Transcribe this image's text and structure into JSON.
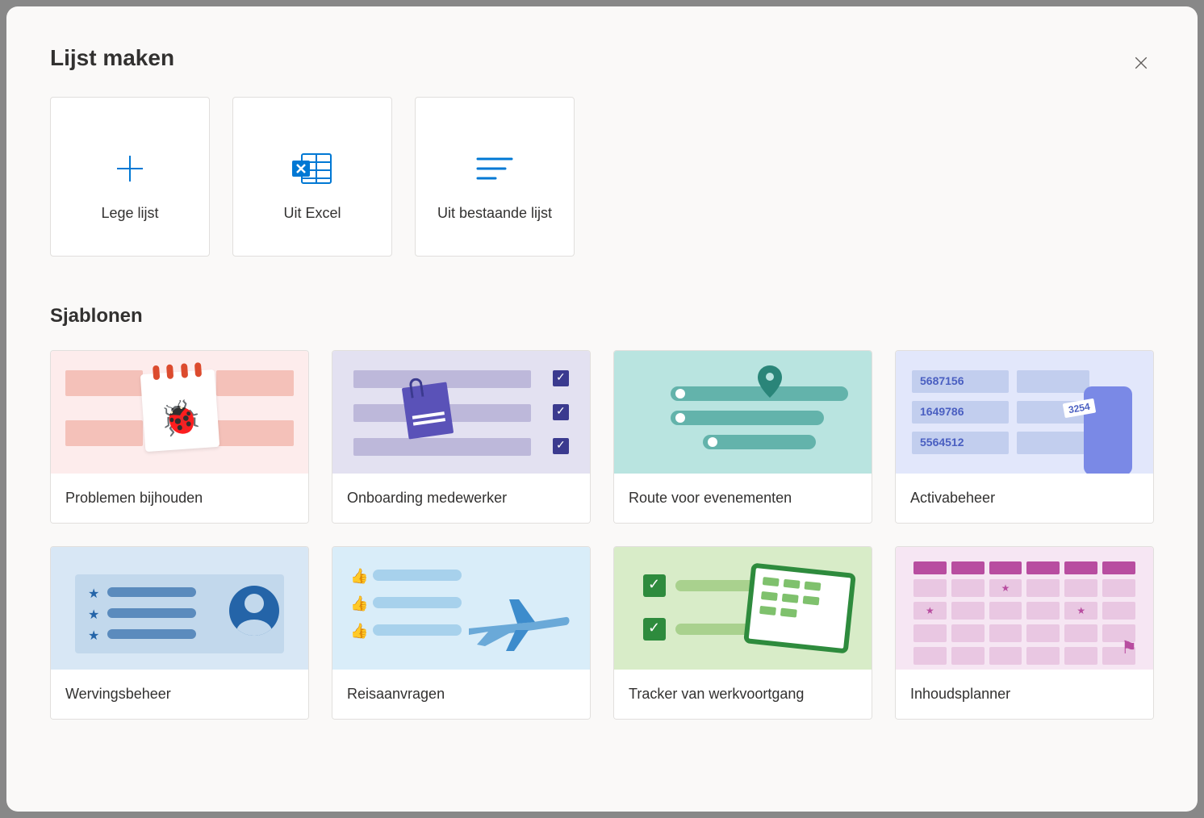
{
  "dialog": {
    "title": "Lijst maken"
  },
  "create_options": {
    "blank": "Lege lijst",
    "from_excel": "Uit Excel",
    "from_existing": "Uit bestaande lijst"
  },
  "templates_heading": "Sjablonen",
  "templates": {
    "issue_tracker": "Problemen bijhouden",
    "employee_onboarding": "Onboarding medewerker",
    "event_itinerary": "Route voor evenementen",
    "asset_manager": "Activabeheer",
    "recruitment": "Wervingsbeheer",
    "travel_requests": "Reisaanvragen",
    "work_progress": "Tracker van werkvoortgang",
    "content_planner": "Inhoudsplanner"
  },
  "asset_illustration": {
    "num1": "5687156",
    "num2": "1649786",
    "num3": "5564512",
    "tag": "3254"
  }
}
